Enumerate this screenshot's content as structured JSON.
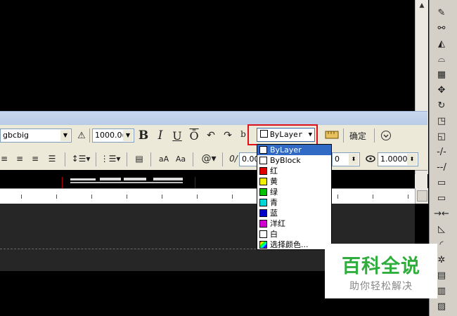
{
  "toolbar": {
    "font_value": "gbcbig",
    "height_value": "1000.0(",
    "bold_label": "B",
    "italic_label": "I",
    "underline_label": "U",
    "overline_label": "Ō",
    "stack_label": "b",
    "color_value": "ByLayer",
    "ok_label": "确定",
    "oblique_value": "0.00",
    "tracking_value": "0",
    "width_value": "1.0000",
    "at_label": "@"
  },
  "color_dropdown": {
    "items": [
      {
        "label": "ByLayer",
        "color": "#ffffff",
        "selected": true
      },
      {
        "label": "ByBlock",
        "color": "#ffffff"
      },
      {
        "label": "红",
        "color": "#e00000"
      },
      {
        "label": "黄",
        "color": "#f0f000"
      },
      {
        "label": "绿",
        "color": "#00c000"
      },
      {
        "label": "青",
        "color": "#00d8d8"
      },
      {
        "label": "蓝",
        "color": "#0000c8"
      },
      {
        "label": "洋红",
        "color": "#d000d0"
      },
      {
        "label": "白",
        "color": "#ffffff"
      },
      {
        "label": "选择颜色...",
        "color": "#ff8040"
      }
    ]
  },
  "watermark": {
    "main": "百科全说",
    "sub": "助你轻松解决"
  },
  "colors": {
    "highlight": "#e0101a",
    "selection": "#316ac5",
    "brand_green": "#2fae3d"
  }
}
